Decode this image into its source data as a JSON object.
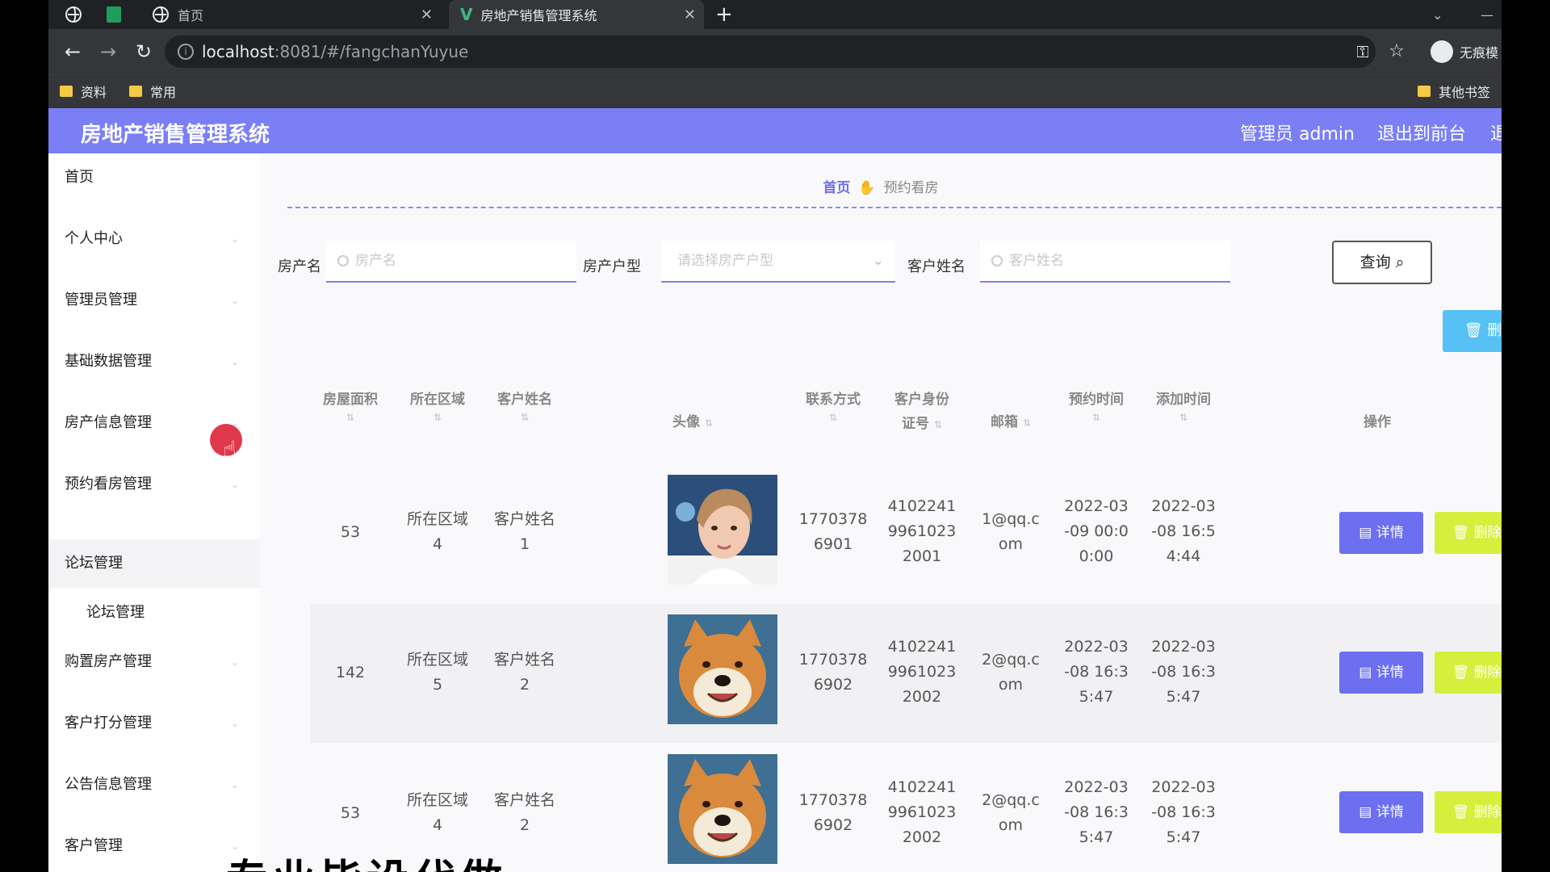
{
  "browser": {
    "tabs": [
      {
        "label": "首页"
      },
      {
        "label": "房地产销售管理系统"
      }
    ],
    "url_host": "localhost",
    "url_path": ":8081/#/fangchanYuyue",
    "profile_label": "无痕模",
    "bookmarks": [
      "资料",
      "常用"
    ],
    "other_bookmarks": "其他书签"
  },
  "header": {
    "title": "房地产销售管理系统",
    "admin": "管理员 admin",
    "exit_front": "退出到前台",
    "exit_short": "退"
  },
  "sidebar": {
    "items": [
      {
        "label": "首页"
      },
      {
        "label": "个人中心"
      },
      {
        "label": "管理员管理"
      },
      {
        "label": "基础数据管理"
      },
      {
        "label": "房产信息管理"
      },
      {
        "label": "预约看房管理"
      },
      {
        "label": "论坛管理"
      },
      {
        "label": "购置房产管理"
      },
      {
        "label": "客户打分管理"
      },
      {
        "label": "公告信息管理"
      },
      {
        "label": "客户管理"
      }
    ],
    "sub_item": "论坛管理"
  },
  "breadcrumb": {
    "home": "首页",
    "current": "预约看房"
  },
  "search": {
    "name_label": "房产名",
    "name_placeholder": "房产名",
    "type_label": "房产户型",
    "type_placeholder": "请选择房产户型",
    "customer_label": "客户姓名",
    "customer_placeholder": "客户姓名",
    "query_button": "查询"
  },
  "toolbar": {
    "delete_label": "删除"
  },
  "table": {
    "headers": {
      "area": "房屋面积",
      "region": "所在区域",
      "customer": "客户姓名",
      "avatar": "头像",
      "phone": "联系方式",
      "id_card_1": "客户身份",
      "id_card_2": "证号",
      "email": "邮箱",
      "appoint_time": "预约时间",
      "add_time": "添加时间",
      "actions": "操作"
    },
    "rows": [
      {
        "area": "53",
        "region": [
          "所在区域",
          "4"
        ],
        "customer": [
          "客户姓名",
          "1"
        ],
        "avatar": "person",
        "phone": [
          "1770378",
          "6901"
        ],
        "id_card": [
          "4102241",
          "9961023",
          "2001"
        ],
        "email": [
          "1@qq.c",
          "om"
        ],
        "appoint": [
          "2022-03",
          "-09 00:0",
          "0:00"
        ],
        "added": [
          "2022-03",
          "-08 16:5",
          "4:44"
        ]
      },
      {
        "area": "142",
        "region": [
          "所在区域",
          "5"
        ],
        "customer": [
          "客户姓名",
          "2"
        ],
        "avatar": "dog",
        "phone": [
          "1770378",
          "6902"
        ],
        "id_card": [
          "4102241",
          "9961023",
          "2002"
        ],
        "email": [
          "2@qq.c",
          "om"
        ],
        "appoint": [
          "2022-03",
          "-08 16:3",
          "5:47"
        ],
        "added": [
          "2022-03",
          "-08 16:3",
          "5:47"
        ]
      },
      {
        "area": "53",
        "region": [
          "所在区域",
          "4"
        ],
        "customer": [
          "客户姓名",
          "2"
        ],
        "avatar": "dog",
        "phone": [
          "1770378",
          "6902"
        ],
        "id_card": [
          "4102241",
          "9961023",
          "2002"
        ],
        "email": [
          "2@qq.c",
          "om"
        ],
        "appoint": [
          "2022-03",
          "-08 16:3",
          "5:47"
        ],
        "added": [
          "2022-03",
          "-08 16:3",
          "5:47"
        ]
      }
    ],
    "detail_label": "详情",
    "delete_label": "删除"
  },
  "overlay_text": "专业毕设代做",
  "colors": {
    "accent": "#7b7ff6",
    "detail": "#6b6ff0",
    "delete": "#d6ef3c",
    "top_delete": "#57c1f5"
  }
}
